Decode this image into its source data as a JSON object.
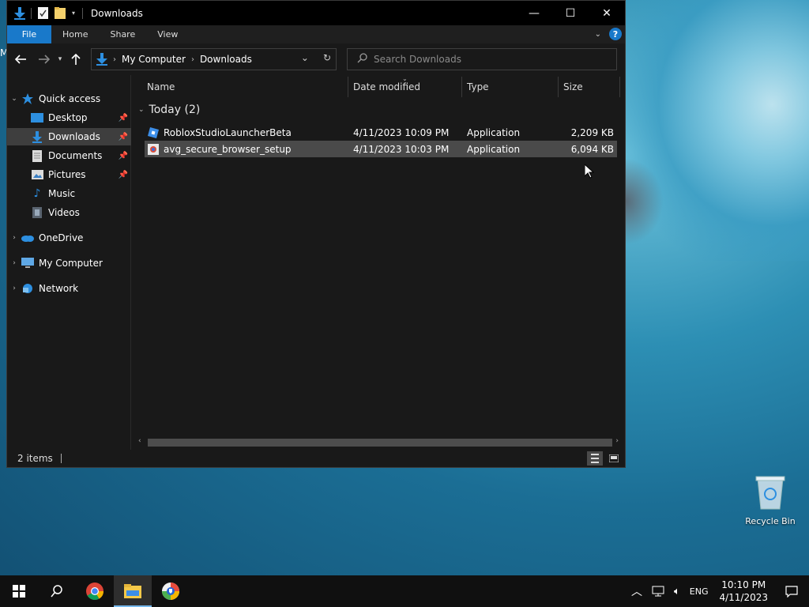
{
  "window": {
    "title": "Downloads",
    "controls": {
      "minimize": "—",
      "maximize": "☐",
      "close": "✕"
    }
  },
  "ribbon": {
    "tabs": [
      "File",
      "Home",
      "Share",
      "View"
    ],
    "help": "?"
  },
  "address": {
    "breadcrumb": [
      "My Computer",
      "Downloads"
    ],
    "search_placeholder": "Search Downloads"
  },
  "nav": {
    "items": [
      {
        "label": "Quick access",
        "pinned": false
      },
      {
        "label": "Desktop",
        "pinned": true
      },
      {
        "label": "Downloads",
        "pinned": true,
        "selected": true
      },
      {
        "label": "Documents",
        "pinned": true
      },
      {
        "label": "Pictures",
        "pinned": true
      },
      {
        "label": "Music",
        "pinned": false
      },
      {
        "label": "Videos",
        "pinned": false
      },
      {
        "label": "OneDrive",
        "pinned": false
      },
      {
        "label": "My Computer",
        "pinned": false
      },
      {
        "label": "Network",
        "pinned": false
      }
    ]
  },
  "columns": [
    "Name",
    "Date modified",
    "Type",
    "Size"
  ],
  "group": {
    "label": "Today (2)"
  },
  "files": [
    {
      "name": "RobloxStudioLauncherBeta",
      "date": "4/11/2023 10:09 PM",
      "type": "Application",
      "size": "2,209 KB"
    },
    {
      "name": "avg_secure_browser_setup",
      "date": "4/11/2023 10:03 PM",
      "type": "Application",
      "size": "6,094 KB"
    }
  ],
  "status": {
    "item_count": "2 items"
  },
  "desktop": {
    "recycle_bin": "Recycle Bin",
    "edge_text": "M"
  },
  "taskbar": {
    "language": "ENG",
    "time": "10:10 PM",
    "date": "4/11/2023"
  },
  "colors": {
    "accent": "#1979ca",
    "window_bg": "#191919",
    "selection": "#4a4a4a"
  }
}
